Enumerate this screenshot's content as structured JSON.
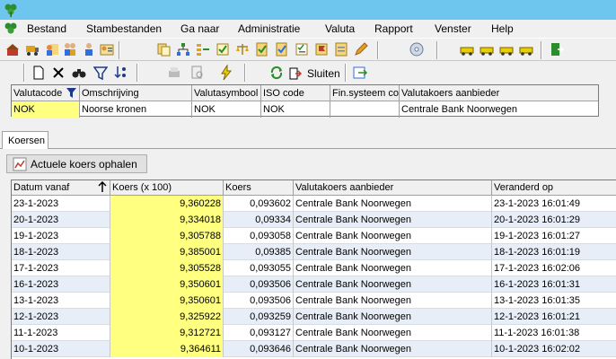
{
  "menu": {
    "items": [
      "Bestand",
      "Stambestanden",
      "Ga naar",
      "Administratie",
      "Valuta",
      "Rapport",
      "Venster",
      "Help"
    ]
  },
  "toolbar2": {
    "close_label": "Sluiten"
  },
  "currency_grid": {
    "headers": [
      "Valutacode",
      "Omschrijving",
      "Valutasymbool",
      "ISO code",
      "Fin.systeem cod",
      "Valutakoers aanbieder"
    ],
    "row": [
      "NOK",
      "Noorse kronen",
      "NOK",
      "NOK",
      "",
      "Centrale Bank Noorwegen"
    ]
  },
  "tab": {
    "label": "Koersen"
  },
  "fetch_button": {
    "label": "Actuele koers ophalen"
  },
  "rates_grid": {
    "headers": [
      "Datum vanaf",
      "Koers (x 100)",
      "Koers",
      "Valutakoers aanbieder",
      "Veranderd op"
    ],
    "rows": [
      [
        "23-1-2023",
        "9,360228",
        "0,093602",
        "Centrale Bank Noorwegen",
        "23-1-2023 16:01:49"
      ],
      [
        "20-1-2023",
        "9,334018",
        "0,09334",
        "Centrale Bank Noorwegen",
        "20-1-2023 16:01:29"
      ],
      [
        "19-1-2023",
        "9,305788",
        "0,093058",
        "Centrale Bank Noorwegen",
        "19-1-2023 16:01:27"
      ],
      [
        "18-1-2023",
        "9,385001",
        "0,09385",
        "Centrale Bank Noorwegen",
        "18-1-2023 16:01:19"
      ],
      [
        "17-1-2023",
        "9,305528",
        "0,093055",
        "Centrale Bank Noorwegen",
        "17-1-2023 16:02:06"
      ],
      [
        "16-1-2023",
        "9,350601",
        "0,093506",
        "Centrale Bank Noorwegen",
        "16-1-2023 16:01:31"
      ],
      [
        "13-1-2023",
        "9,350601",
        "0,093506",
        "Centrale Bank Noorwegen",
        "13-1-2023 16:01:35"
      ],
      [
        "12-1-2023",
        "9,325922",
        "0,093259",
        "Centrale Bank Noorwegen",
        "12-1-2023 16:01:21"
      ],
      [
        "11-1-2023",
        "9,312721",
        "0,093127",
        "Centrale Bank Noorwegen",
        "11-1-2023 16:01:38"
      ],
      [
        "10-1-2023",
        "9,364611",
        "0,093646",
        "Centrale Bank Noorwegen",
        "10-1-2023 16:02:02"
      ]
    ]
  },
  "colors": {
    "titlebar": "#6ec6ee",
    "highlight": "#ffff80",
    "alt_row": "#e8eef8"
  }
}
